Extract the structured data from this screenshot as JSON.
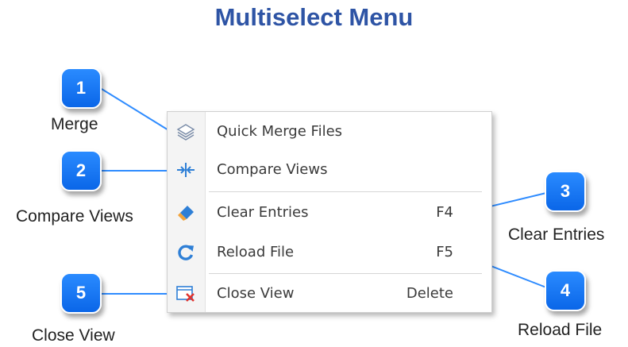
{
  "title": "Multiselect Menu",
  "menu": {
    "items": [
      {
        "label": "Quick Merge Files",
        "shortcut": "",
        "icon": "layers-icon"
      },
      {
        "label": "Compare Views",
        "shortcut": "",
        "icon": "compare-split-icon"
      },
      {
        "label": "Clear Entries",
        "shortcut": "F4",
        "icon": "eraser-icon"
      },
      {
        "label": "Reload File",
        "shortcut": "F5",
        "icon": "reload-icon"
      },
      {
        "label": "Close View",
        "shortcut": "Delete",
        "icon": "close-view-icon"
      }
    ]
  },
  "callouts": [
    {
      "number": "1",
      "label": "Merge"
    },
    {
      "number": "2",
      "label": "Compare Views"
    },
    {
      "number": "3",
      "label": "Clear Entries"
    },
    {
      "number": "4",
      "label": "Reload File"
    },
    {
      "number": "5",
      "label": "Close View"
    }
  ],
  "colors": {
    "title": "#2e54a5",
    "badge": "#0f6ff0",
    "leader_line": "#2f8cff",
    "icon_blue": "#2e7fd6",
    "icon_orange": "#f2a33a",
    "icon_red": "#e0332e"
  }
}
